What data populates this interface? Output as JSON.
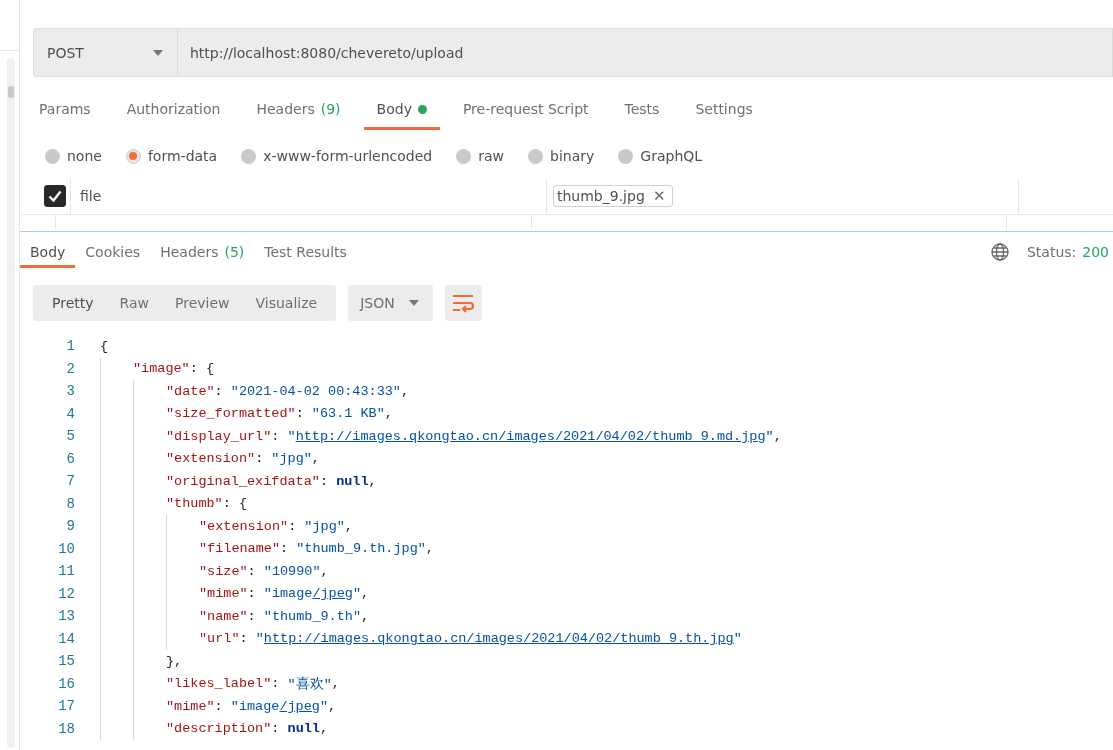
{
  "request": {
    "method": "POST",
    "url": "http://localhost:8080/chevereto/upload"
  },
  "request_tabs": [
    {
      "label": "Params",
      "selected": false
    },
    {
      "label": "Authorization",
      "selected": false
    },
    {
      "label": "Headers",
      "count": "(9)",
      "selected": false
    },
    {
      "label": "Body",
      "indicator": true,
      "selected": true
    },
    {
      "label": "Pre-request Script",
      "selected": false
    },
    {
      "label": "Tests",
      "selected": false
    },
    {
      "label": "Settings",
      "selected": false
    }
  ],
  "body_types": [
    {
      "label": "none",
      "selected": false
    },
    {
      "label": "form-data",
      "selected": true
    },
    {
      "label": "x-www-form-urlencoded",
      "selected": false
    },
    {
      "label": "raw",
      "selected": false
    },
    {
      "label": "binary",
      "selected": false
    },
    {
      "label": "GraphQL",
      "selected": false
    }
  ],
  "form_rows": [
    {
      "checked": true,
      "key": "file",
      "file": "thumb_9.jpg",
      "remove": "✕"
    }
  ],
  "response_tabs": [
    {
      "label": "Body",
      "selected": true
    },
    {
      "label": "Cookies",
      "selected": false
    },
    {
      "label": "Headers",
      "count": "(5)",
      "selected": false
    },
    {
      "label": "Test Results",
      "selected": false
    }
  ],
  "status": {
    "label": "Status:",
    "value": "200"
  },
  "view_modes": [
    {
      "label": "Pretty",
      "selected": true
    },
    {
      "label": "Raw",
      "selected": false
    },
    {
      "label": "Preview",
      "selected": false
    },
    {
      "label": "Visualize",
      "selected": false
    }
  ],
  "format": "JSON",
  "code": [
    {
      "num": "1",
      "tokens": [
        {
          "kind": "punct",
          "text": "{"
        }
      ],
      "children": [
        {
          "num": "2",
          "tokens": [
            {
              "kind": "key",
              "text": "\"image\""
            },
            {
              "kind": "punct",
              "text": ": {"
            }
          ],
          "children": [
            {
              "num": "3",
              "tokens": [
                {
                  "kind": "key",
                  "text": "\"date\""
                },
                {
                  "kind": "punct",
                  "text": ": "
                },
                {
                  "kind": "string",
                  "text": "\"2021-04-02 00:43:33\""
                },
                {
                  "kind": "punct",
                  "text": ","
                }
              ]
            },
            {
              "num": "4",
              "tokens": [
                {
                  "kind": "key",
                  "text": "\"size_formatted\""
                },
                {
                  "kind": "punct",
                  "text": ": "
                },
                {
                  "kind": "string",
                  "text": "\"63.1 KB\""
                },
                {
                  "kind": "punct",
                  "text": ","
                }
              ]
            },
            {
              "num": "5",
              "tokens": [
                {
                  "kind": "key",
                  "text": "\"display_url\""
                },
                {
                  "kind": "punct",
                  "text": ": "
                },
                {
                  "kind": "string",
                  "text": "\""
                },
                {
                  "kind": "link",
                  "text": "http://images.qkongtao.cn/images/2021/04/02/thumb_9.md.jpg"
                },
                {
                  "kind": "string",
                  "text": "\""
                },
                {
                  "kind": "punct",
                  "text": ","
                }
              ]
            },
            {
              "num": "6",
              "tokens": [
                {
                  "kind": "key",
                  "text": "\"extension\""
                },
                {
                  "kind": "punct",
                  "text": ": "
                },
                {
                  "kind": "string",
                  "text": "\"jpg\""
                },
                {
                  "kind": "punct",
                  "text": ","
                }
              ]
            },
            {
              "num": "7",
              "tokens": [
                {
                  "kind": "key",
                  "text": "\"original_exifdata\""
                },
                {
                  "kind": "punct",
                  "text": ": "
                },
                {
                  "kind": "keyword",
                  "text": "null"
                },
                {
                  "kind": "punct",
                  "text": ","
                }
              ]
            },
            {
              "num": "8",
              "tokens": [
                {
                  "kind": "key",
                  "text": "\"thumb\""
                },
                {
                  "kind": "punct",
                  "text": ": {"
                }
              ],
              "children": [
                {
                  "num": "9",
                  "tokens": [
                    {
                      "kind": "key",
                      "text": "\"extension\""
                    },
                    {
                      "kind": "punct",
                      "text": ": "
                    },
                    {
                      "kind": "string",
                      "text": "\"jpg\""
                    },
                    {
                      "kind": "punct",
                      "text": ","
                    }
                  ]
                },
                {
                  "num": "10",
                  "tokens": [
                    {
                      "kind": "key",
                      "text": "\"filename\""
                    },
                    {
                      "kind": "punct",
                      "text": ": "
                    },
                    {
                      "kind": "string",
                      "text": "\"thumb_9.th.jpg\""
                    },
                    {
                      "kind": "punct",
                      "text": ","
                    }
                  ]
                },
                {
                  "num": "11",
                  "tokens": [
                    {
                      "kind": "key",
                      "text": "\"size\""
                    },
                    {
                      "kind": "punct",
                      "text": ": "
                    },
                    {
                      "kind": "string",
                      "text": "\"10990\""
                    },
                    {
                      "kind": "punct",
                      "text": ","
                    }
                  ]
                },
                {
                  "num": "12",
                  "tokens": [
                    {
                      "kind": "key",
                      "text": "\"mime\""
                    },
                    {
                      "kind": "punct",
                      "text": ": "
                    },
                    {
                      "kind": "string",
                      "text": "\"image"
                    },
                    {
                      "kind": "link",
                      "text": "/jpeg"
                    },
                    {
                      "kind": "string",
                      "text": "\""
                    },
                    {
                      "kind": "punct",
                      "text": ","
                    }
                  ]
                },
                {
                  "num": "13",
                  "tokens": [
                    {
                      "kind": "key",
                      "text": "\"name\""
                    },
                    {
                      "kind": "punct",
                      "text": ": "
                    },
                    {
                      "kind": "string",
                      "text": "\"thumb_9.th\""
                    },
                    {
                      "kind": "punct",
                      "text": ","
                    }
                  ]
                },
                {
                  "num": "14",
                  "tokens": [
                    {
                      "kind": "key",
                      "text": "\"url\""
                    },
                    {
                      "kind": "punct",
                      "text": ": "
                    },
                    {
                      "kind": "string",
                      "text": "\""
                    },
                    {
                      "kind": "link",
                      "text": "http://images.qkongtao.cn/images/2021/04/02/thumb_9.th.jpg"
                    },
                    {
                      "kind": "string",
                      "text": "\""
                    }
                  ]
                }
              ]
            },
            {
              "num": "15",
              "tokens": [
                {
                  "kind": "punct",
                  "text": "},"
                }
              ]
            },
            {
              "num": "16",
              "tokens": [
                {
                  "kind": "key",
                  "text": "\"likes_label\""
                },
                {
                  "kind": "punct",
                  "text": ": "
                },
                {
                  "kind": "string",
                  "text": "\"喜欢\""
                },
                {
                  "kind": "punct",
                  "text": ","
                }
              ]
            },
            {
              "num": "17",
              "tokens": [
                {
                  "kind": "key",
                  "text": "\"mime\""
                },
                {
                  "kind": "punct",
                  "text": ": "
                },
                {
                  "kind": "string",
                  "text": "\"image"
                },
                {
                  "kind": "link",
                  "text": "/jpeg"
                },
                {
                  "kind": "string",
                  "text": "\""
                },
                {
                  "kind": "punct",
                  "text": ","
                }
              ]
            },
            {
              "num": "18",
              "tokens": [
                {
                  "kind": "key",
                  "text": "\"description\""
                },
                {
                  "kind": "punct",
                  "text": ": "
                },
                {
                  "kind": "keyword",
                  "text": "null"
                },
                {
                  "kind": "punct",
                  "text": ","
                }
              ]
            }
          ]
        }
      ]
    }
  ]
}
